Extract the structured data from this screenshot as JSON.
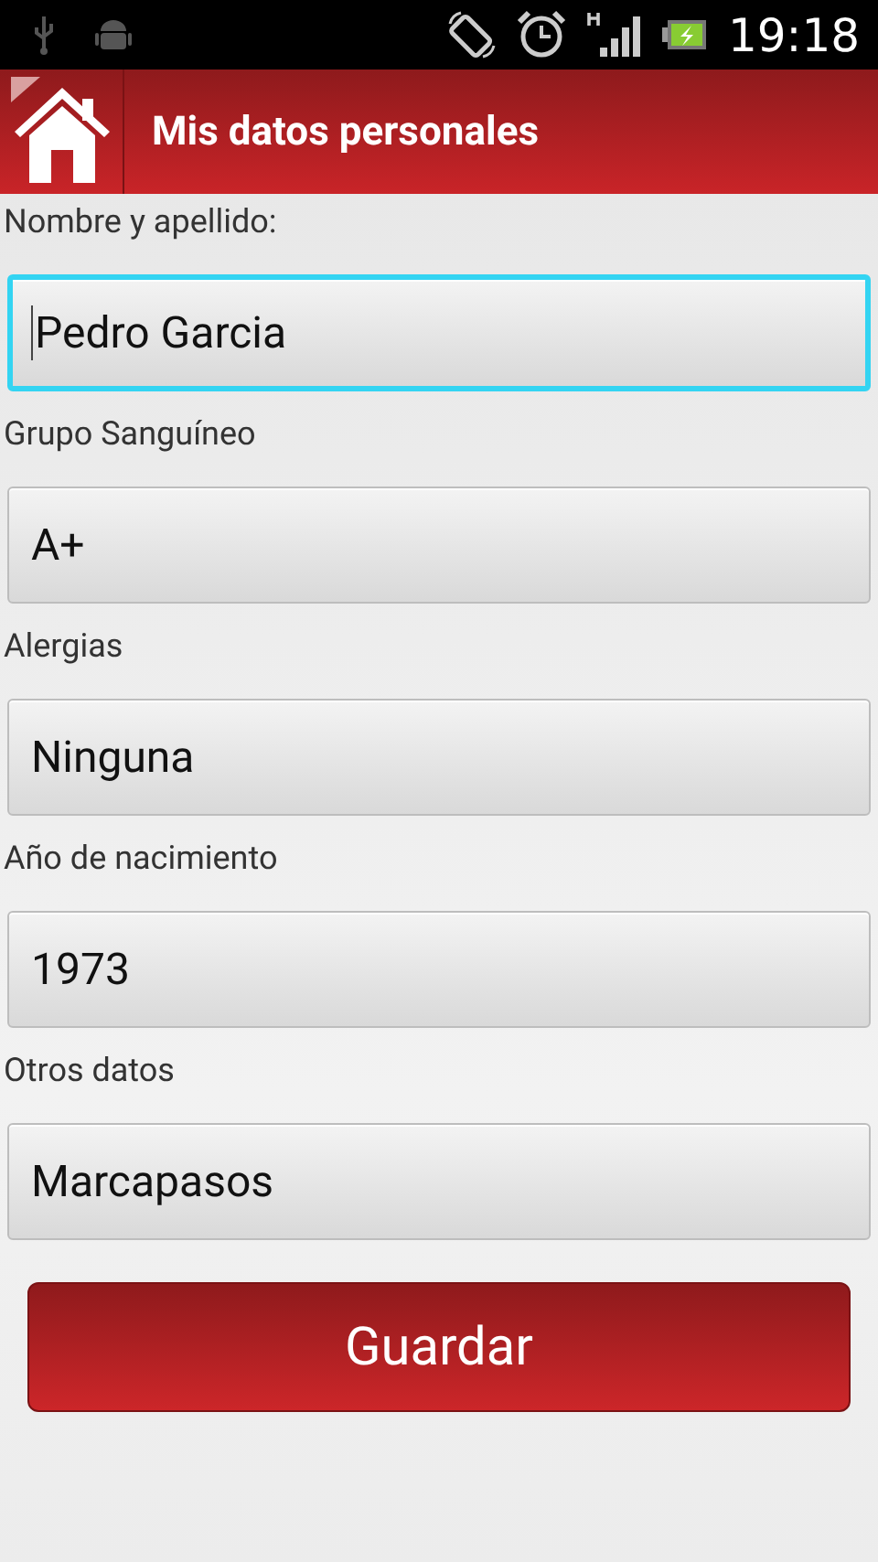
{
  "status_bar": {
    "time": "19:18"
  },
  "app_bar": {
    "title": "Mis datos personales"
  },
  "fields": [
    {
      "label": "Nombre y apellido:",
      "value": "Pedro Garcia",
      "focused": true
    },
    {
      "label": "Grupo Sanguíneo",
      "value": "A+",
      "focused": false
    },
    {
      "label": "Alergias",
      "value": "Ninguna",
      "focused": false
    },
    {
      "label": "Año de nacimiento",
      "value": "1973",
      "focused": false
    },
    {
      "label": "Otros datos",
      "value": "Marcapasos",
      "focused": false
    }
  ],
  "save_button": "Guardar"
}
